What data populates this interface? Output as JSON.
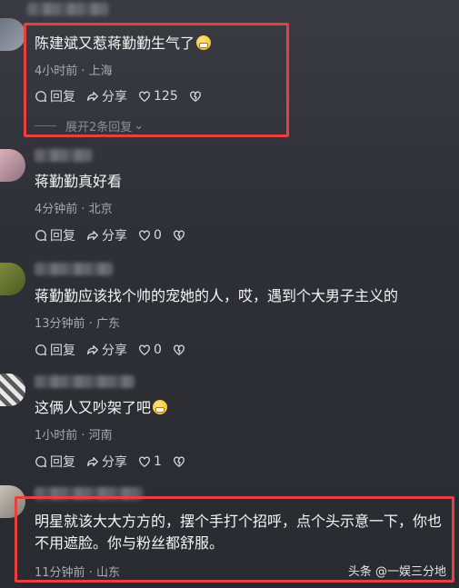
{
  "comments": [
    {
      "text": "陈建斌又惹蒋勤勤生气了",
      "emoji": "grimace-emoji",
      "meta": "4小时前 · 上海",
      "reply_label": "回复",
      "share_label": "分享",
      "likes": "125",
      "expand_label": "展开2条回复"
    },
    {
      "text": "蒋勤勤真好看",
      "meta": "4分钟前 · 北京",
      "reply_label": "回复",
      "share_label": "分享",
      "likes": "0"
    },
    {
      "text": "蒋勤勤应该找个帅的宠她的人，哎，遇到个大男子主义的",
      "meta": "13分钟前 · 广东",
      "reply_label": "回复",
      "share_label": "分享",
      "likes": "0"
    },
    {
      "text": "这俩人又吵架了吧",
      "emoji": "grimace-emoji",
      "meta": "1小时前 · 河南",
      "reply_label": "回复",
      "share_label": "分享",
      "likes": "1"
    },
    {
      "text": "明星就该大大方方的，摆个手打个招呼，点个头示意一下，你也不用遮脸。你与粉丝都舒服。",
      "meta": "11分钟前 · 山东"
    }
  ],
  "watermark": "头条 @一娱三分地",
  "colors": {
    "highlight_border": "#e8403f",
    "background": "#2f3037",
    "meta_text": "#a9abb2"
  }
}
